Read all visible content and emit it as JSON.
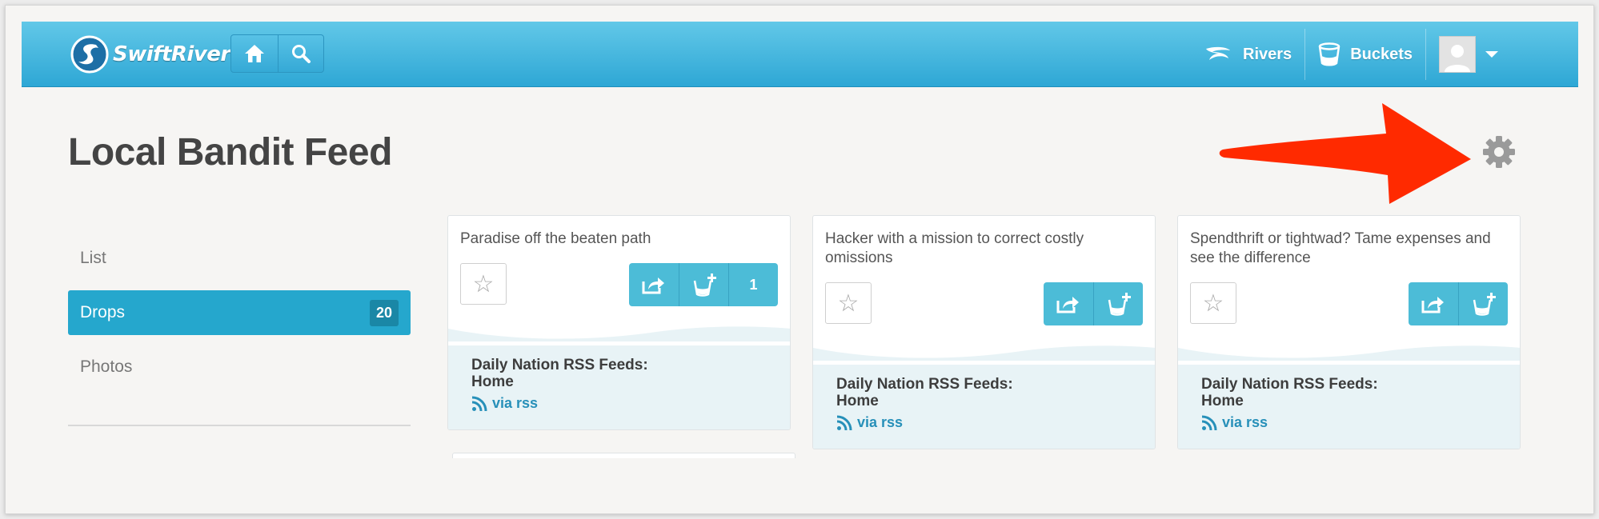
{
  "header": {
    "logo_text": "SwiftRiver",
    "nav": {
      "rivers": "Rivers",
      "buckets": "Buckets"
    }
  },
  "page": {
    "title": "Local Bandit Feed"
  },
  "sidebar": {
    "items": [
      {
        "label": "List"
      },
      {
        "label": "Drops",
        "count": "20"
      },
      {
        "label": "Photos"
      }
    ]
  },
  "drops": [
    {
      "title": "Paradise off the beaten path",
      "bucket_count": "1",
      "source": "Daily Nation RSS Feeds: Home",
      "source_line1": "Daily Nation RSS Feeds:",
      "source_line2": "Home",
      "via": "via rss"
    },
    {
      "title": "Hacker with a mission to correct costly omissions",
      "bucket_count": "",
      "source_line1": "Daily Nation RSS Feeds:",
      "source_line2": "Home",
      "via": "via rss"
    },
    {
      "title": "Spendthrift or tightwad? Tame expenses and see the difference",
      "bucket_count": "",
      "source_line1": "Daily Nation RSS Feeds:",
      "source_line2": "Home",
      "via": "via rss"
    }
  ],
  "colors": {
    "header": "#3bb3de",
    "accent": "#25a7cd",
    "arrow": "#ff2a00",
    "link": "#2790b9"
  }
}
